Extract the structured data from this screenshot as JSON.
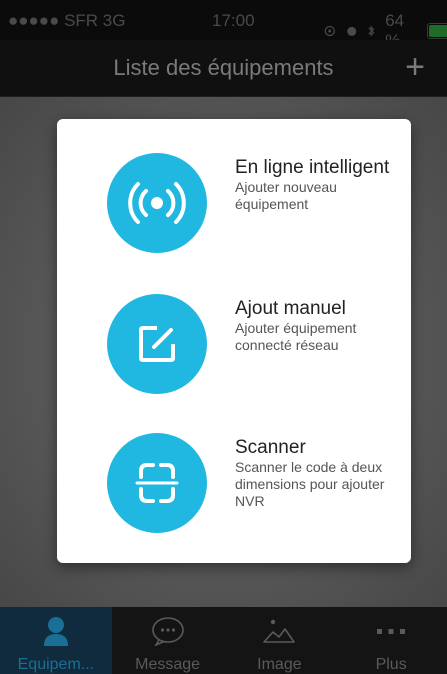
{
  "status_bar": {
    "signal": "●●●●● SFR 3G",
    "time": "17:00",
    "battery_text": "64 %",
    "battery_level": 0.64
  },
  "header": {
    "title": "Liste des équipements",
    "add_label": "+"
  },
  "modal": {
    "options": [
      {
        "title": "En ligne intelligent",
        "description": "Ajouter nouveau équipement",
        "icon": "broadcast-icon"
      },
      {
        "title": "Ajout manuel",
        "description": "Ajouter équipement connecté réseau",
        "icon": "edit-icon"
      },
      {
        "title": "Scanner",
        "description": "Scanner le code à deux dimensions pour ajouter NVR",
        "icon": "scan-icon"
      }
    ]
  },
  "tabs": [
    {
      "label": "Equipem...",
      "icon": "person-icon",
      "active": true
    },
    {
      "label": "Message",
      "icon": "message-icon",
      "active": false
    },
    {
      "label": "Image",
      "icon": "image-icon",
      "active": false
    },
    {
      "label": "Plus",
      "icon": "more-icon",
      "active": false
    }
  ],
  "colors": {
    "accent": "#20b8e1",
    "tab_active": "#1a6f96"
  }
}
